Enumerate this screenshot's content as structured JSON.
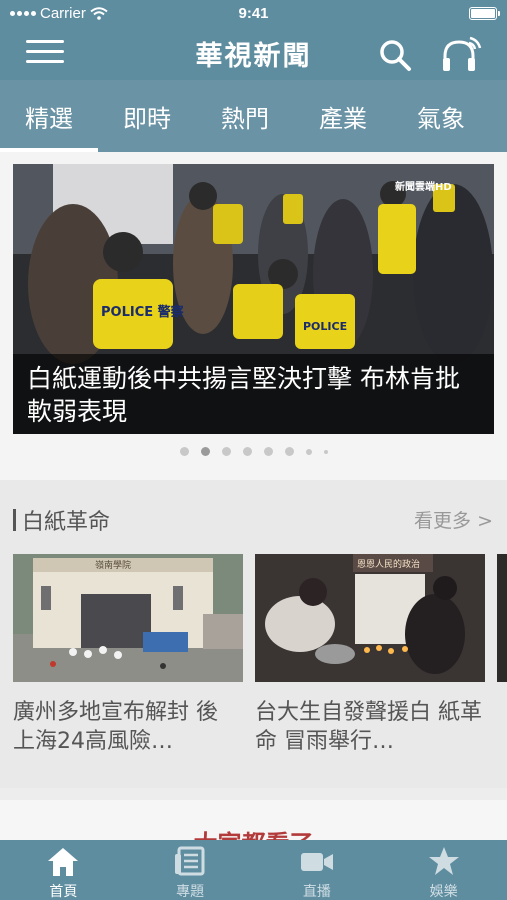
{
  "status_bar": {
    "carrier": "Carrier",
    "time": "9:41"
  },
  "header": {
    "title": "華視新聞"
  },
  "category_tabs": [
    {
      "label": "精選"
    },
    {
      "label": "即時"
    },
    {
      "label": "熱門"
    },
    {
      "label": "產業"
    },
    {
      "label": "氣象"
    }
  ],
  "hero": {
    "caption": "白紙運動後中共揚言堅決打擊 布林肯批軟弱表現",
    "image_text": {
      "police_left": "POLICE 警察",
      "police_right": "POLICE",
      "logo": "新聞雲端HD"
    },
    "page_count": 8,
    "current_page": 2
  },
  "section": {
    "title": "白紙革命",
    "more_label": "看更多 >",
    "cards": [
      {
        "title": "廣州多地宣布解封 後 上海24高風險…",
        "image_text": "嶺南學院"
      },
      {
        "title": "台大生自發聲援白 紙革命 冒雨舉行…",
        "image_text": "恩恩人民的政治"
      }
    ]
  },
  "section2": {
    "title": "大家都看了"
  },
  "tab_bar": [
    {
      "label": "首頁",
      "icon": "home-icon"
    },
    {
      "label": "專題",
      "icon": "news-icon"
    },
    {
      "label": "直播",
      "icon": "video-camera-icon"
    },
    {
      "label": "娛樂",
      "icon": "star-icon"
    }
  ],
  "colors": {
    "brand": "#5f8da0",
    "tabs_bg": "#6a93a5",
    "accent_red": "#b33a3a",
    "badge_yellow": "#e8d21a"
  }
}
